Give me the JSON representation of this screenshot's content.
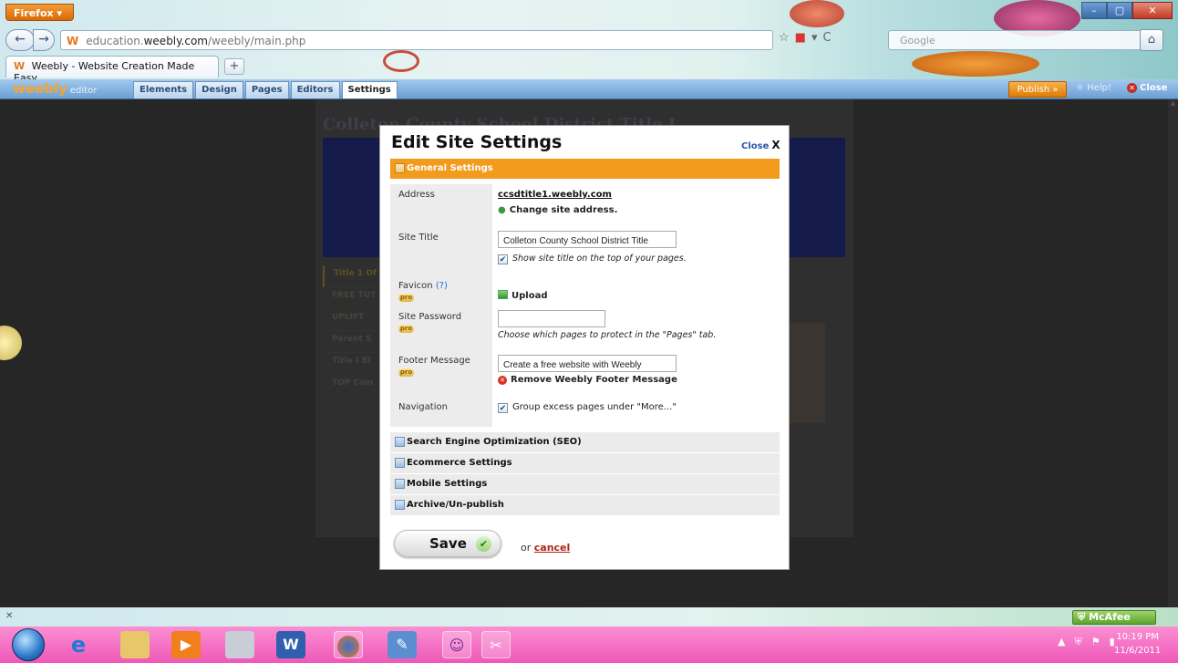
{
  "browser": {
    "menu_button": "Firefox ▾",
    "url_prefix": "education.",
    "url_domain": "weebly.com",
    "url_path": "/weebly/main.php",
    "search_placeholder": "Google",
    "tab_title": "Weebly - Website Creation Made Easy",
    "new_tab": "+",
    "tab_favicon": "W",
    "url_favicon": "W",
    "colors": {
      "firefox_orange": "#e07a1f",
      "chrome_blue": "#7b93b0"
    },
    "icons": [
      "back-icon",
      "forward-icon",
      "bookmark-star-icon",
      "reload-icon",
      "home-icon",
      "bookmarks-icon"
    ]
  },
  "weebly_toolbar": {
    "logo": "weebly",
    "logo_suffix": "editor",
    "tabs": [
      {
        "label": "Elements",
        "active": false
      },
      {
        "label": "Design",
        "active": false
      },
      {
        "label": "Pages",
        "active": false
      },
      {
        "label": "Editors",
        "active": false
      },
      {
        "label": "Settings",
        "active": true
      }
    ],
    "publish": "Publish »",
    "help": "Help!",
    "close": "Close",
    "colors": {
      "publish": "#e98e1b",
      "bar": "#8ab6e2"
    }
  },
  "background_site": {
    "title": "Colleton County School District Title I",
    "nav_items": [
      "Title 1 Of",
      "FREE TUT",
      "UPLIFT",
      "Parent S",
      "Title I Bl",
      "TOP Com"
    ]
  },
  "modal": {
    "title": "Edit Site Settings",
    "close": "Close",
    "close_glyph": "X",
    "sections": {
      "general": "General Settings",
      "seo": "Search Engine Optimization (SEO)",
      "ecommerce": "Ecommerce Settings",
      "mobile": "Mobile Settings",
      "archive": "Archive/Un-publish"
    },
    "address": {
      "label": "Address",
      "value": "ccsdtitle1.weebly.com",
      "change_link": "Change site address."
    },
    "site_title": {
      "label": "Site Title",
      "value": "Colleton County School District Title",
      "checkbox_label": "Show site title on the top of your pages.",
      "checked": true
    },
    "favicon": {
      "label": "Favicon",
      "help": "(?)",
      "pro_badge": "pro",
      "upload": "Upload"
    },
    "site_password": {
      "label": "Site Password",
      "pro_badge": "pro",
      "value": "",
      "hint": "Choose which pages to protect in the \"Pages\" tab."
    },
    "footer": {
      "label": "Footer Message",
      "pro_badge": "pro",
      "value": "Create a free website with Weebly",
      "remove_link": "Remove Weebly Footer Message"
    },
    "navigation": {
      "label": "Navigation",
      "checkbox_label": "Group excess pages under \"More...\"",
      "checked": true
    },
    "save": "Save",
    "or": "or",
    "cancel": "cancel",
    "colors": {
      "general_header": "#f29b1d",
      "cancel": "#b0231a",
      "address_link": "#111111"
    }
  },
  "taskbar": {
    "mcafee": "McAfee",
    "time": "10:19 PM",
    "date": "11/6/2011",
    "apps": [
      "start-orb",
      "ie-icon",
      "explorer-icon",
      "media-player-icon",
      "calculator-icon",
      "word-icon",
      "firefox-icon",
      "paint-icon",
      "yahoo-messenger-icon",
      "snipping-tool-icon"
    ]
  }
}
